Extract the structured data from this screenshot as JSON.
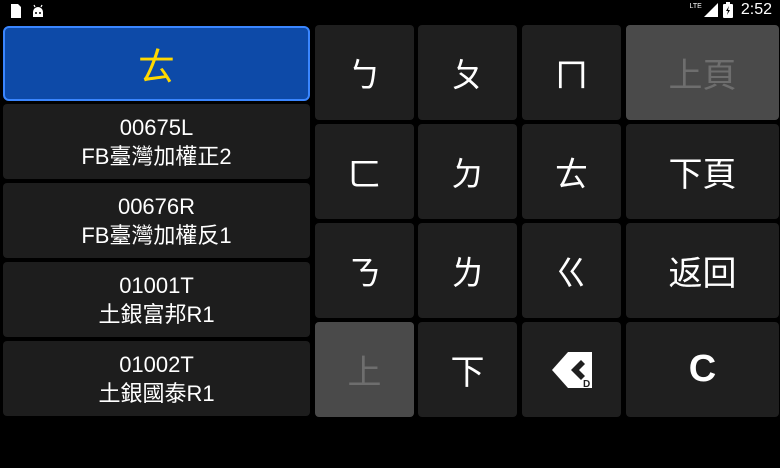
{
  "status_bar": {
    "network": "LTE",
    "time": "2:52"
  },
  "input": {
    "value": "ㄊ"
  },
  "stocks": [
    {
      "code": "00675L",
      "name": "FB臺灣加權正2"
    },
    {
      "code": "00676R",
      "name": "FB臺灣加權反1"
    },
    {
      "code": "01001T",
      "name": "土銀富邦R1"
    },
    {
      "code": "01002T",
      "name": "土銀國泰R1"
    }
  ],
  "keypad": {
    "bo": "ㄅ",
    "po": "ㄆ",
    "mo": "ㄇ",
    "fo": "ㄈ",
    "de": "ㄉ",
    "te": "ㄊ",
    "ne": "ㄋ",
    "le": "ㄌ",
    "ge": "ㄍ",
    "page_up": "上頁",
    "page_down": "下頁",
    "back": "返回",
    "up": "上",
    "down": "下",
    "clear": "C"
  }
}
